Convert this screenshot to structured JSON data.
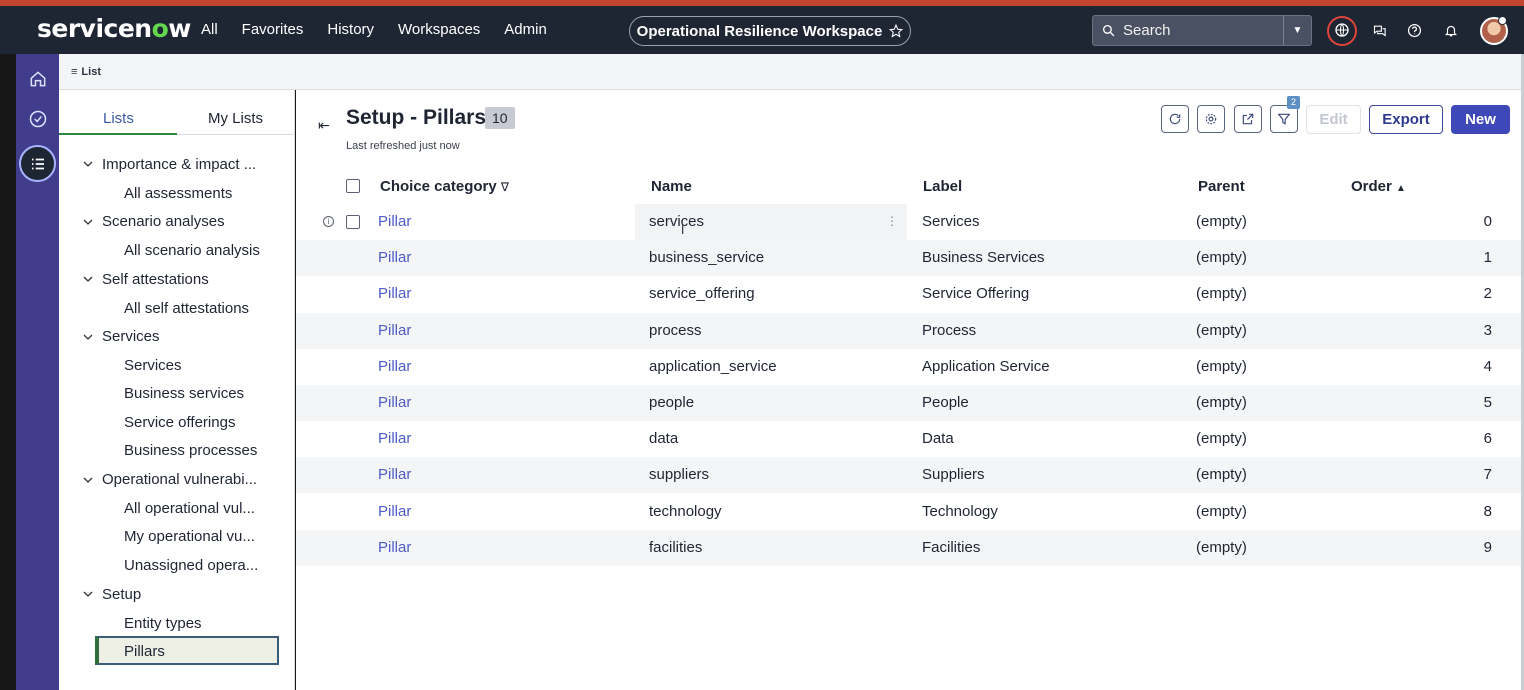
{
  "brand": {
    "logo_text_1": "servicen",
    "logo_o": "o",
    "logo_text_2": "w"
  },
  "topnav": {
    "menu": [
      "All",
      "Favorites",
      "History",
      "Workspaces",
      "Admin"
    ],
    "workspace_label": "Operational Resilience Workspace",
    "search_placeholder": "Search"
  },
  "breadcrumb": {
    "label": "List"
  },
  "sidebar": {
    "tabs": [
      "Lists",
      "My Lists"
    ],
    "groups": [
      {
        "label": "Importance & impact ...",
        "children": [
          "All assessments"
        ]
      },
      {
        "label": "Scenario analyses",
        "children": [
          "All scenario analysis"
        ]
      },
      {
        "label": "Self attestations",
        "children": [
          "All self attestations"
        ]
      },
      {
        "label": "Services",
        "children": [
          "Services",
          "Business services",
          "Service offerings",
          "Business processes"
        ]
      },
      {
        "label": "Operational vulnerabi...",
        "children": [
          "All operational vul...",
          "My operational vu...",
          "Unassigned opera..."
        ]
      },
      {
        "label": "Setup",
        "children": [
          "Entity types",
          "Pillars"
        ]
      }
    ],
    "selected": "Pillars"
  },
  "list": {
    "title": "Setup - Pillars",
    "count": "10",
    "refreshed": "Last refreshed just now",
    "filter_count": "2",
    "buttons": {
      "edit": "Edit",
      "export": "Export",
      "new": "New"
    },
    "columns": [
      "Choice category",
      "Name",
      "Label",
      "Parent",
      "Order"
    ],
    "rows": [
      {
        "category": "Pillar",
        "name": "services",
        "label": "Services",
        "parent": "(empty)",
        "order": "0"
      },
      {
        "category": "Pillar",
        "name": "business_service",
        "label": "Business Services",
        "parent": "(empty)",
        "order": "1"
      },
      {
        "category": "Pillar",
        "name": "service_offering",
        "label": "Service Offering",
        "parent": "(empty)",
        "order": "2"
      },
      {
        "category": "Pillar",
        "name": "process",
        "label": "Process",
        "parent": "(empty)",
        "order": "3"
      },
      {
        "category": "Pillar",
        "name": "application_service",
        "label": "Application Service",
        "parent": "(empty)",
        "order": "4"
      },
      {
        "category": "Pillar",
        "name": "people",
        "label": "People",
        "parent": "(empty)",
        "order": "5"
      },
      {
        "category": "Pillar",
        "name": "data",
        "label": "Data",
        "parent": "(empty)",
        "order": "6"
      },
      {
        "category": "Pillar",
        "name": "suppliers",
        "label": "Suppliers",
        "parent": "(empty)",
        "order": "7"
      },
      {
        "category": "Pillar",
        "name": "technology",
        "label": "Technology",
        "parent": "(empty)",
        "order": "8"
      },
      {
        "category": "Pillar",
        "name": "facilities",
        "label": "Facilities",
        "parent": "(empty)",
        "order": "9"
      }
    ]
  },
  "icons": {
    "rail": [
      "home-icon",
      "check-circle-icon",
      "list-icon"
    ],
    "header": [
      "globe-icon",
      "chat-icon",
      "help-icon",
      "bell-icon"
    ],
    "toolbar": [
      "refresh-icon",
      "settings-icon",
      "share-icon",
      "filter-icon"
    ]
  },
  "colors": {
    "accent": "#3f48b8",
    "rail": "#413d8c",
    "topnav": "#1e2533",
    "link": "#4d5cc8",
    "alert": "#c2452f"
  }
}
